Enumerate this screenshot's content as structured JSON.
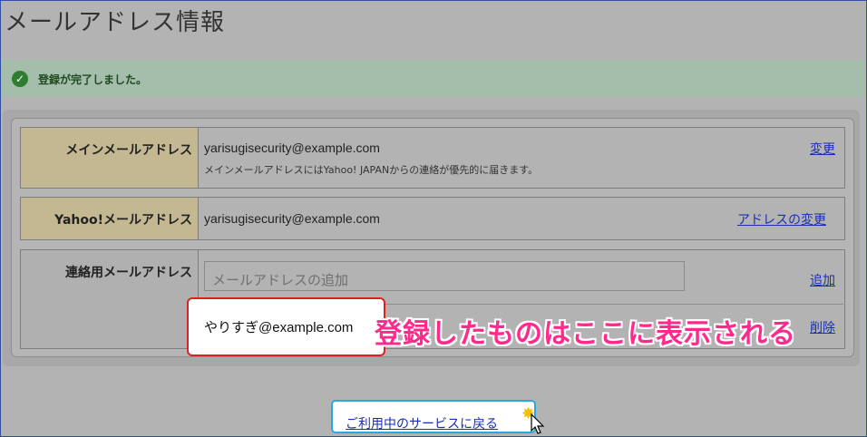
{
  "page": {
    "title": "メールアドレス情報"
  },
  "notice": {
    "text": "登録が完了しました。",
    "icon": "check-circle-icon"
  },
  "rows": {
    "main": {
      "label": "メインメールアドレス",
      "value": "yarisugisecurity@example.com",
      "note": "メインメールアドレスにはYahoo! JAPANからの連絡が優先的に届きます。",
      "link": "変更"
    },
    "yahoo": {
      "label": "Yahoo!メールアドレス",
      "value": "yarisugisecurity@example.com",
      "link": "アドレスの変更"
    },
    "contact": {
      "label": "連絡用メールアドレス",
      "input_placeholder": "メールアドレスの追加",
      "add_link": "追加",
      "registered": "やりすぎ@example.com",
      "delete_link": "削除"
    }
  },
  "annotation": "登録したものはここに表示される",
  "back_button": "ご利用中のサービスに戻る",
  "colors": {
    "accent_red": "#e02020",
    "annotation_pink": "#ff2a8c",
    "link_blue": "#1a2fb0",
    "success_green": "#2e7d32"
  }
}
